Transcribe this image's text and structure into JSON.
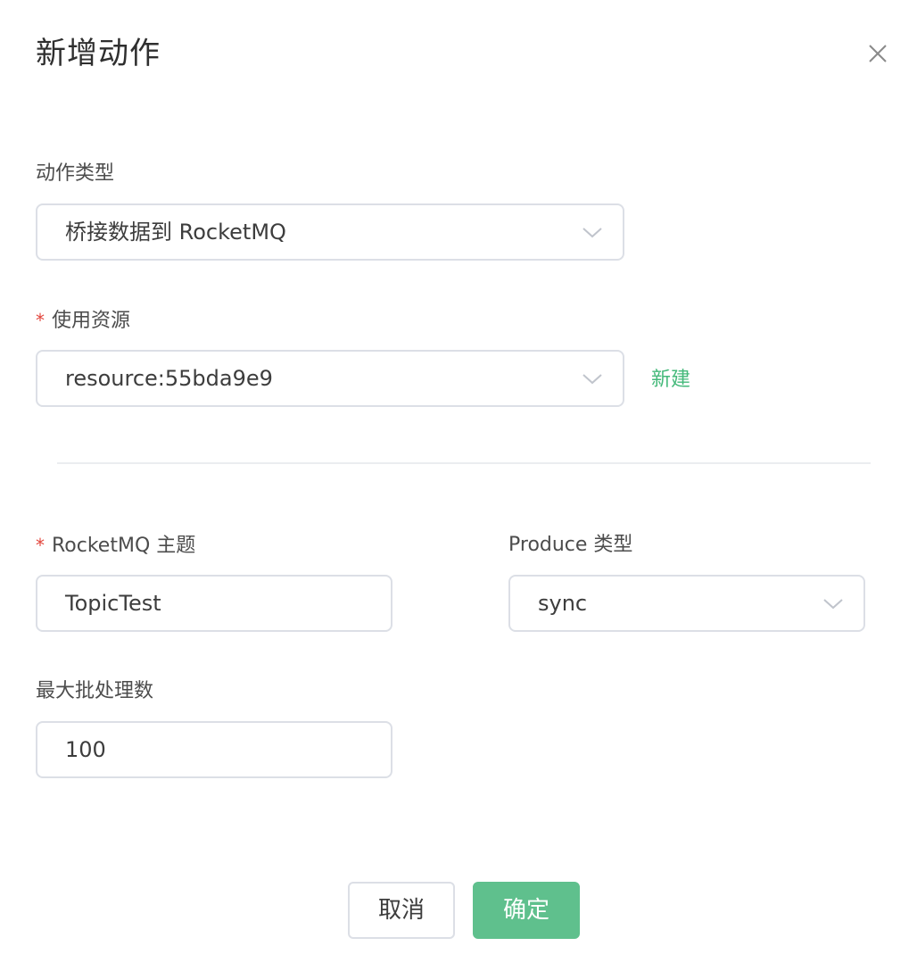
{
  "dialog": {
    "title": "新增动作"
  },
  "form": {
    "action_type": {
      "label": "动作类型",
      "value": "桥接数据到 RocketMQ"
    },
    "resource": {
      "required_mark": "*",
      "label": "使用资源",
      "value": "resource:55bda9e9",
      "new_link": "新建"
    },
    "topic": {
      "required_mark": "*",
      "label": "RocketMQ 主题",
      "value": "TopicTest"
    },
    "produce_type": {
      "label": "Produce 类型",
      "value": "sync"
    },
    "max_batch": {
      "label": "最大批处理数",
      "value": "100"
    }
  },
  "footer": {
    "cancel_label": "取消",
    "confirm_label": "确定"
  },
  "colors": {
    "accent": "#5fc08d",
    "link": "#44b97a",
    "required": "#e2453c",
    "border": "#dcdfe6"
  },
  "icons": {
    "close": "close-icon",
    "dropdown": "chevron-down-icon"
  }
}
